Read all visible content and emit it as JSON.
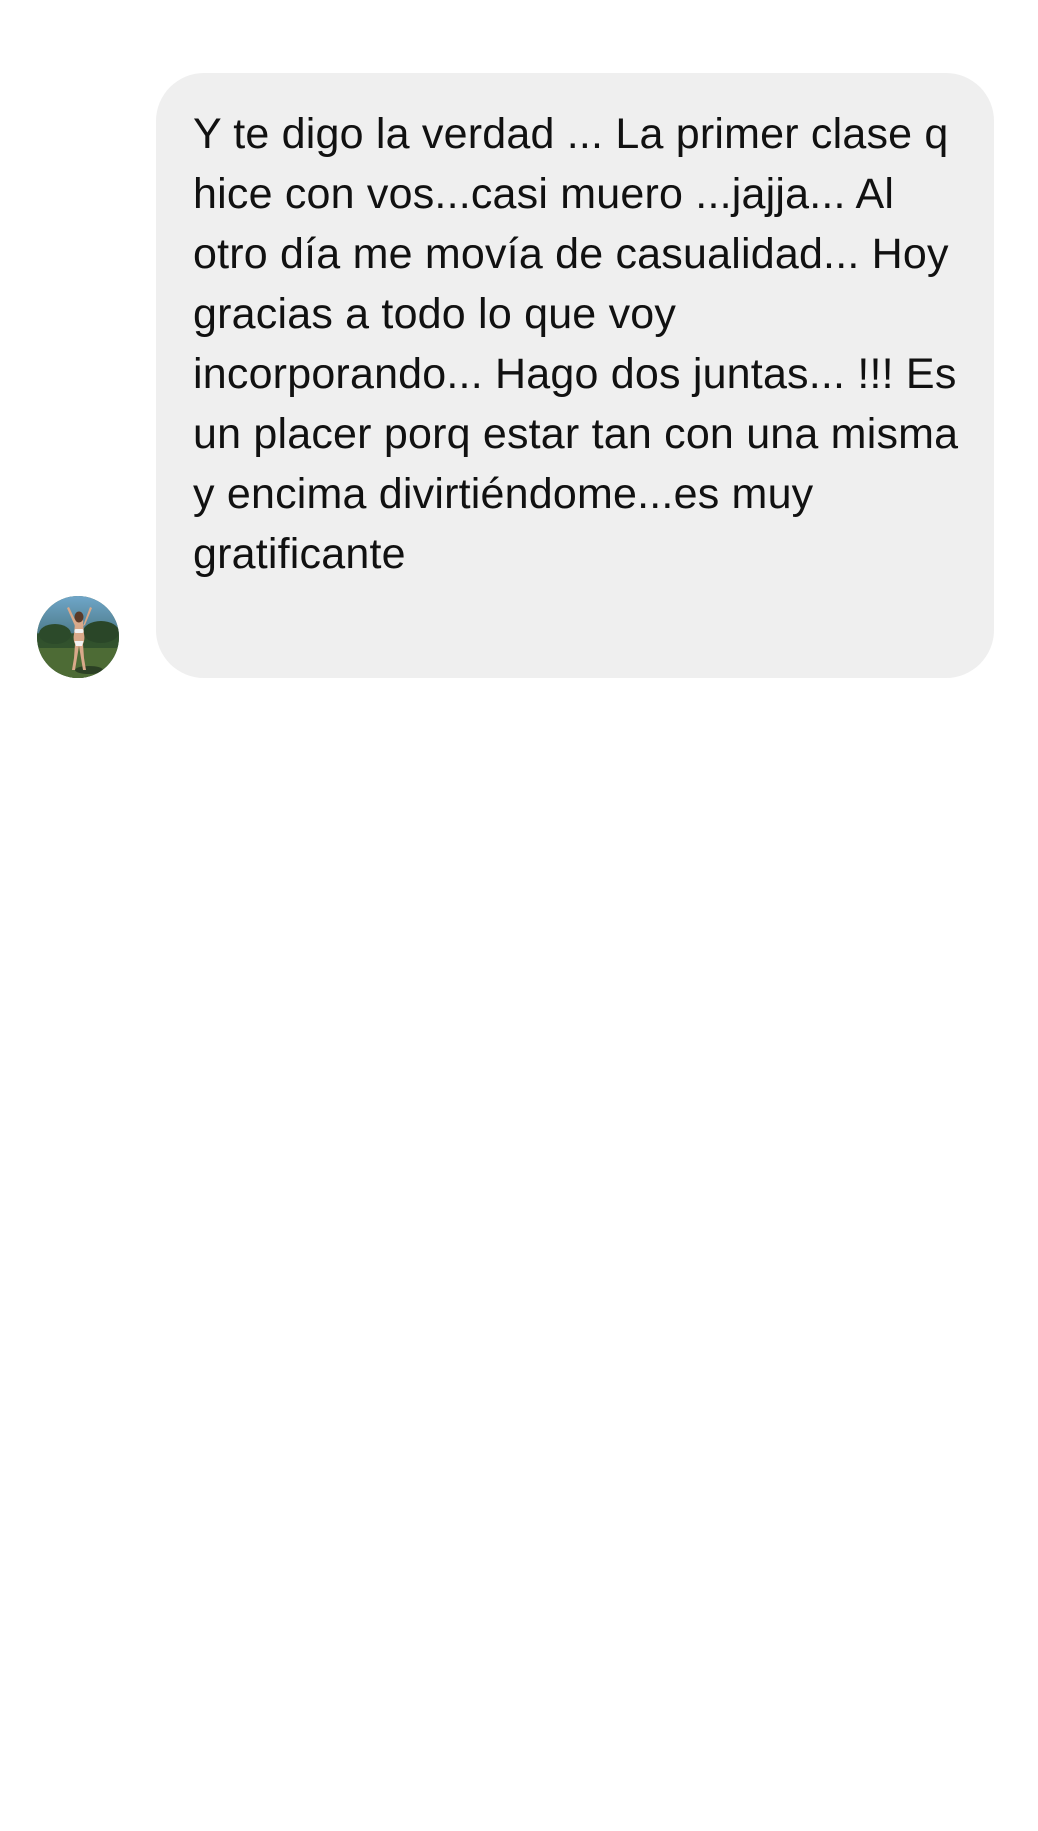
{
  "thread": {
    "messages": [
      {
        "sender_avatar_icon": "profile-photo-avatar",
        "text": "Y te digo la verdad ... La primer clase q hice con vos...casi muero ...jajja... Al otro día me movía de casualidad... Hoy gracias a todo lo que voy incorporando... Hago dos juntas... !!! Es un placer porq estar tan con una misma y encima divirtiéndome...es muy gratificante"
      }
    ]
  },
  "colors": {
    "background": "#ffffff",
    "bubble": "#efefef",
    "text": "#111111"
  }
}
